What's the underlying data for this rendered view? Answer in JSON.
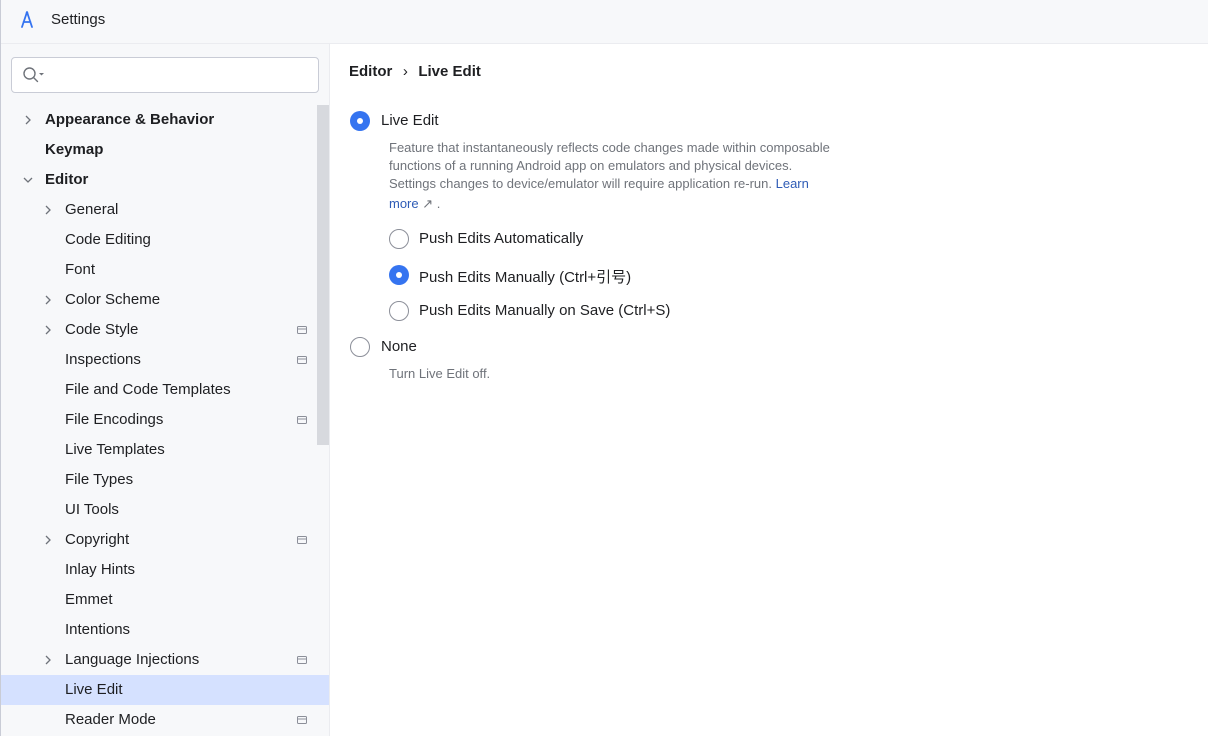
{
  "window": {
    "title": "Settings"
  },
  "search": {
    "value": "",
    "placeholder": ""
  },
  "tree": [
    {
      "label": "Appearance & Behavior",
      "level": 0,
      "expandable": true,
      "expanded": false,
      "bold": true,
      "project_scope": false
    },
    {
      "label": "Keymap",
      "level": 0,
      "expandable": false,
      "bold": true,
      "project_scope": false
    },
    {
      "label": "Editor",
      "level": 0,
      "expandable": true,
      "expanded": true,
      "bold": true,
      "project_scope": false
    },
    {
      "label": "General",
      "level": 1,
      "expandable": true,
      "expanded": false,
      "project_scope": false
    },
    {
      "label": "Code Editing",
      "level": 1,
      "expandable": false,
      "project_scope": false
    },
    {
      "label": "Font",
      "level": 1,
      "expandable": false,
      "project_scope": false
    },
    {
      "label": "Color Scheme",
      "level": 1,
      "expandable": true,
      "expanded": false,
      "project_scope": false
    },
    {
      "label": "Code Style",
      "level": 1,
      "expandable": true,
      "expanded": false,
      "project_scope": true
    },
    {
      "label": "Inspections",
      "level": 1,
      "expandable": false,
      "project_scope": true
    },
    {
      "label": "File and Code Templates",
      "level": 1,
      "expandable": false,
      "project_scope": false
    },
    {
      "label": "File Encodings",
      "level": 1,
      "expandable": false,
      "project_scope": true
    },
    {
      "label": "Live Templates",
      "level": 1,
      "expandable": false,
      "project_scope": false
    },
    {
      "label": "File Types",
      "level": 1,
      "expandable": false,
      "project_scope": false
    },
    {
      "label": "UI Tools",
      "level": 1,
      "expandable": false,
      "project_scope": false
    },
    {
      "label": "Copyright",
      "level": 1,
      "expandable": true,
      "expanded": false,
      "project_scope": true
    },
    {
      "label": "Inlay Hints",
      "level": 1,
      "expandable": false,
      "project_scope": false
    },
    {
      "label": "Emmet",
      "level": 1,
      "expandable": false,
      "project_scope": false
    },
    {
      "label": "Intentions",
      "level": 1,
      "expandable": false,
      "project_scope": false
    },
    {
      "label": "Language Injections",
      "level": 1,
      "expandable": true,
      "expanded": false,
      "project_scope": true
    },
    {
      "label": "Live Edit",
      "level": 1,
      "expandable": false,
      "selected": true,
      "project_scope": false
    },
    {
      "label": "Reader Mode",
      "level": 1,
      "expandable": false,
      "project_scope": true
    }
  ],
  "breadcrumb": {
    "parent": "Editor",
    "separator": "›",
    "current": "Live Edit"
  },
  "live_edit": {
    "option_label": "Live Edit",
    "checked": true,
    "description_lines": [
      "Feature that instantaneously reflects code changes made within composable",
      "functions of a running Android app on emulators and physical devices.",
      "Settings changes to device/emulator will require application re-run."
    ],
    "learn_label": "Learn",
    "more_label": "more",
    "more_arrow": "↗",
    "trailing_period": ".",
    "sub_options": [
      {
        "label": "Push Edits Automatically",
        "checked": false
      },
      {
        "label": "Push Edits Manually (Ctrl+引号)",
        "checked": true
      },
      {
        "label": "Push Edits Manually on Save (Ctrl+S)",
        "checked": false
      }
    ]
  },
  "none_option": {
    "label": "None",
    "checked": false,
    "description": "Turn Live Edit off."
  },
  "colors": {
    "accent": "#3574f0",
    "link": "#2f5cb6",
    "selection": "#d5e1ff",
    "sidebar_bg": "#f7f8fa"
  }
}
